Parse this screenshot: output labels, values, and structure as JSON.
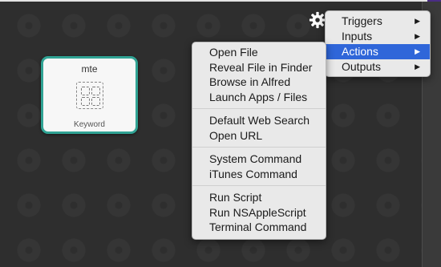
{
  "node": {
    "title": "mte",
    "subtitle": "Keyword",
    "accent_color": "#30a394"
  },
  "main_menu": {
    "items": [
      {
        "label": "Triggers",
        "arrow": "▶"
      },
      {
        "label": "Inputs",
        "arrow": "▶"
      },
      {
        "label": "Actions",
        "arrow": "▶"
      },
      {
        "label": "Outputs",
        "arrow": "▶"
      }
    ]
  },
  "actions_menu": {
    "groups": [
      [
        "Open File",
        "Reveal File in Finder",
        "Browse in Alfred",
        "Launch Apps / Files"
      ],
      [
        "Default Web Search",
        "Open URL"
      ],
      [
        "System Command",
        "iTunes Command"
      ],
      [
        "Run Script",
        "Run NSAppleScript",
        "Terminal Command"
      ]
    ]
  },
  "colors": {
    "highlight": "#2f66d9",
    "canvas": "#2e2e2e"
  }
}
